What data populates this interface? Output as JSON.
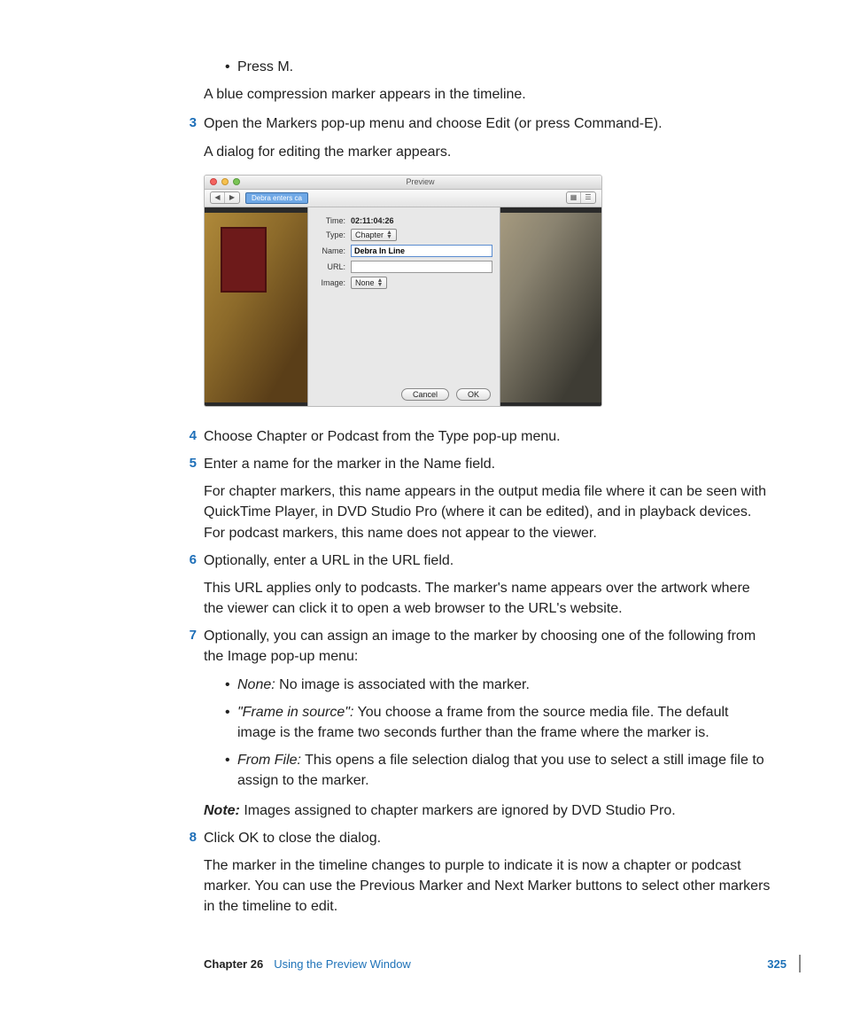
{
  "intro": {
    "bullet": "Press M.",
    "after": "A blue compression marker appears in the timeline."
  },
  "steps": [
    {
      "num": "3",
      "lead": "Open the Markers pop-up menu and choose Edit (or press Command-E).",
      "sub": "A dialog for editing the marker appears."
    },
    {
      "num": "4",
      "lead": "Choose Chapter or Podcast from the Type pop-up menu."
    },
    {
      "num": "5",
      "lead": "Enter a name for the marker in the Name field.",
      "sub": "For chapter markers, this name appears in the output media file where it can be seen with QuickTime Player, in DVD Studio Pro (where it can be edited), and in playback devices. For podcast markers, this name does not appear to the viewer."
    },
    {
      "num": "6",
      "lead": "Optionally, enter a URL in the URL field.",
      "sub": "This URL applies only to podcasts. The marker's name appears over the artwork where the viewer can click it to open a web browser to the URL's website."
    },
    {
      "num": "7",
      "lead": "Optionally, you can assign an image to the marker by choosing one of the following from the Image pop-up menu:",
      "bullets": [
        {
          "term": "None:",
          "text": "  No image is associated with the marker."
        },
        {
          "term": "\"Frame in source\":",
          "text": "  You choose a frame from the source media file. The default image is the frame two seconds further than the frame where the marker is."
        },
        {
          "term": "From File:",
          "text": "  This opens a file selection dialog that you use to select a still image file to assign to the marker."
        }
      ],
      "noteLabel": "Note:",
      "noteText": "  Images assigned to chapter markers are ignored by DVD Studio Pro."
    },
    {
      "num": "8",
      "lead": "Click OK to close the dialog.",
      "sub": "The marker in the timeline changes to purple to indicate it is now a chapter or podcast marker. You can use the Previous Marker and Next Marker buttons to select other markers in the timeline to edit."
    }
  ],
  "figure": {
    "windowTitle": "Preview",
    "pin": "Debra enters ca",
    "timeLabel": "Time:",
    "timeValue": "02:11:04:26",
    "typeLabel": "Type:",
    "typeValue": "Chapter",
    "nameLabel": "Name:",
    "nameValue": "Debra In Line",
    "urlLabel": "URL:",
    "imageLabel": "Image:",
    "imageValue": "None",
    "cancel": "Cancel",
    "ok": "OK"
  },
  "footer": {
    "chapter": "Chapter 26",
    "title": "Using the Preview Window",
    "page": "325"
  }
}
